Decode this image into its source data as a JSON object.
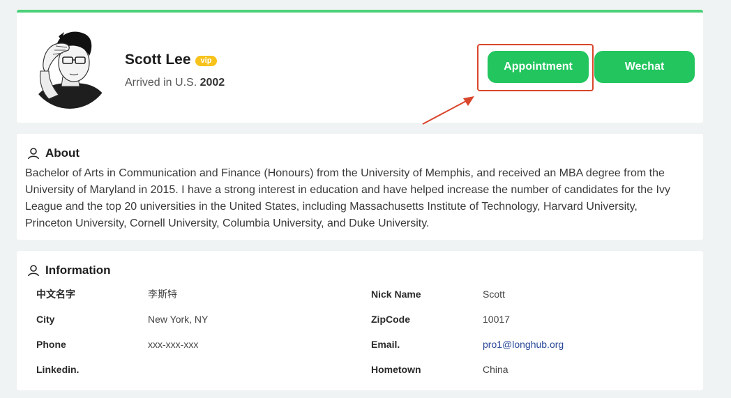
{
  "profile": {
    "name": "Scott Lee",
    "vip_label": "vip",
    "arrived_prefix": "Arrived in U.S.",
    "arrived_year": "2002",
    "appointment_label": "Appointment",
    "wechat_label": "Wechat",
    "accent_color": "#22c55e",
    "top_bar_color": "#4cd17a",
    "vip_color": "#f7c21a",
    "annotation_color": "#d9462b"
  },
  "about": {
    "title": "About",
    "icon": "person-icon",
    "text": "Bachelor of Arts in Communication and Finance (Honours) from the University of Memphis, and received an MBA degree from the University of Maryland in 2015. I have a strong interest in education and have helped increase the number of candidates for the Ivy League and the top 20 universities in the United States, including Massachusetts Institute of Technology, Harvard University, Princeton University, Cornell University, Columbia University, and Duke University."
  },
  "information": {
    "title": "Information",
    "icon": "person-icon",
    "rows": [
      {
        "label1": "中文名字",
        "value1": "李斯特",
        "label2": "Nick Name",
        "value2": "Scott"
      },
      {
        "label1": "City",
        "value1": "New York, NY",
        "label2": "ZipCode",
        "value2": "10017"
      },
      {
        "label1": "Phone",
        "value1": "xxx-xxx-xxx",
        "label2": "Email.",
        "value2": "pro1@longhub.org"
      },
      {
        "label1": "Linkedin.",
        "value1": "",
        "label2": "Hometown",
        "value2": "China"
      }
    ]
  }
}
